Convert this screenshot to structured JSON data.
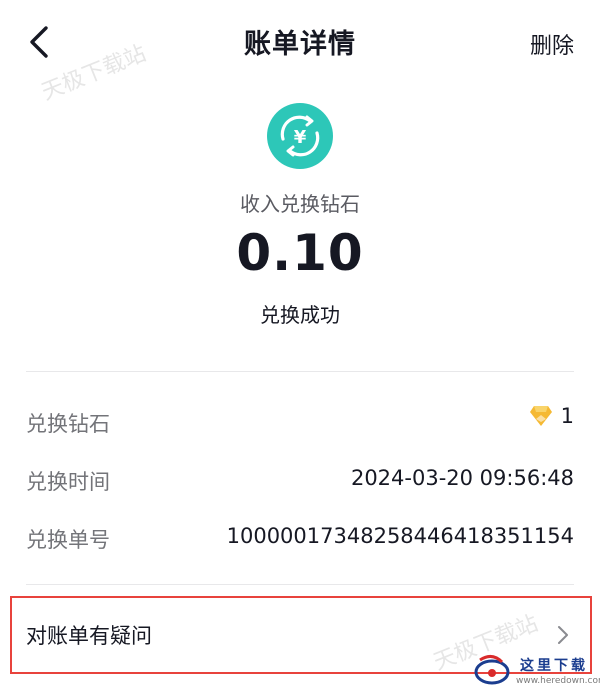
{
  "header": {
    "title": "账单详情",
    "delete_label": "删除"
  },
  "summary": {
    "icon": "yuan-coin-icon",
    "type_label": "收入兑换钻石",
    "amount": "0.10",
    "status": "兑换成功"
  },
  "details": {
    "rows": [
      {
        "label": "兑换钻石",
        "value": "1",
        "icon": "diamond-icon"
      },
      {
        "label": "兑换时间",
        "value": "2024-03-20 09:56:48"
      },
      {
        "label": "兑换单号",
        "value": "100000173482584464183511​54"
      }
    ]
  },
  "faq": {
    "label": "对账单有疑问"
  },
  "watermarks": [
    "天极下载站",
    "天极下载站"
  ],
  "brand": {
    "name": "这里下载",
    "url": "www.heredown.com"
  },
  "colors": {
    "accent_teal": "#2dc7b8",
    "diamond_gold": "#f5b933",
    "highlight_border": "#e8433c"
  }
}
